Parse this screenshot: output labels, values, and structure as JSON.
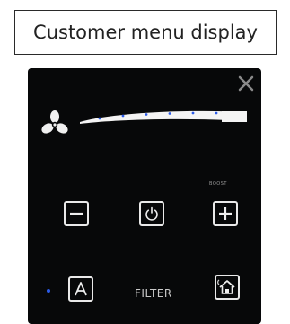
{
  "caption": {
    "title": "Customer menu display"
  },
  "panel": {
    "close_icon": "close-icon",
    "fan_icon": "fan-icon",
    "speed_meter": {
      "level": 0.72,
      "steps": 7,
      "accent": "#2b5be8"
    },
    "buttons": {
      "minus": {
        "icon": "minus-icon"
      },
      "power": {
        "icon": "power-icon"
      },
      "plus": {
        "icon": "plus-icon",
        "label": "BOOST"
      },
      "auto": {
        "icon": "letter-a",
        "glyph": "A",
        "indicator_color": "#2b5be8"
      },
      "home": {
        "icon": "home-settings-icon"
      }
    },
    "filter_label": "FILTER"
  }
}
